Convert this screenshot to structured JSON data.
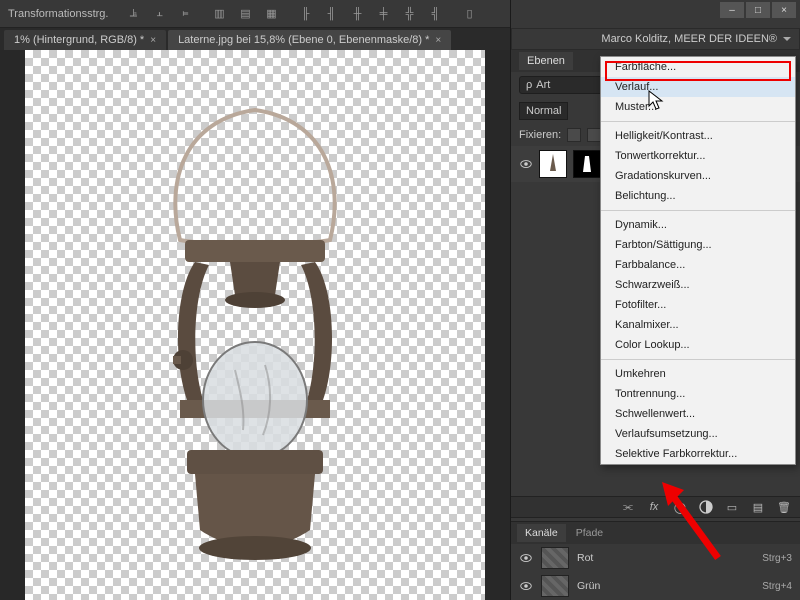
{
  "topbar": {
    "label": "Transformationsstrg."
  },
  "tabs": [
    {
      "label": "1% (Hintergrund, RGB/8) *",
      "active": false
    },
    {
      "label": "Laterne.jpg bei 15,8% (Ebene 0, Ebenenmaske/8) *",
      "active": true
    }
  ],
  "window_buttons": {
    "minimize": "–",
    "maximize": "□",
    "close": "×"
  },
  "workspace": "Marco Kolditz, MEER DER IDEEN®",
  "layers_panel": {
    "tab": "Ebenen",
    "search_prefix": "ρ",
    "search_label": "Art",
    "blend_mode": "Normal",
    "lock_label": "Fixieren:"
  },
  "adjustment_menu": {
    "highlighted": "Farbfläche...",
    "groups": [
      [
        "Farbfläche...",
        "Verlauf...",
        "Muster..."
      ],
      [
        "Helligkeit/Kontrast...",
        "Tonwertkorrektur...",
        "Gradationskurven...",
        "Belichtung..."
      ],
      [
        "Dynamik...",
        "Farbton/Sättigung...",
        "Farbbalance...",
        "Schwarzweiß...",
        "Fotofilter...",
        "Kanalmixer...",
        "Color Lookup..."
      ],
      [
        "Umkehren",
        "Tontrennung...",
        "Schwellenwert...",
        "Verlaufsumsetzung...",
        "Selektive Farbkorrektur..."
      ]
    ]
  },
  "bottom_strip_icons": [
    "link",
    "fx",
    "mask",
    "adjust",
    "group",
    "new",
    "trash"
  ],
  "channels_panel": {
    "tabs": [
      "Kanäle",
      "Pfade"
    ],
    "active": 0,
    "rows": [
      {
        "name": "Rot",
        "shortcut": "Strg+3"
      },
      {
        "name": "Grün",
        "shortcut": "Strg+4"
      }
    ]
  }
}
